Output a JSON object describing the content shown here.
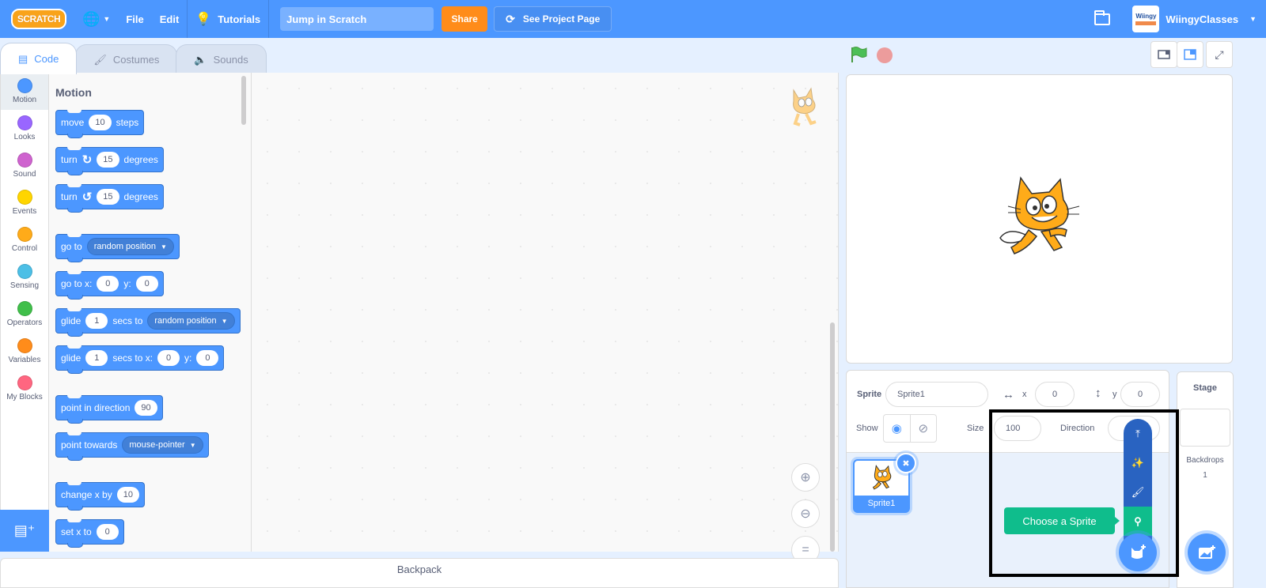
{
  "menubar": {
    "logo": "SCRATCH",
    "language_icon": "globe-icon",
    "file": "File",
    "edit": "Edit",
    "tutorials": "Tutorials",
    "project_title": "Jump in Scratch",
    "share": "Share",
    "see_project_page": "See Project Page",
    "avatar_text": "Wiingy",
    "username": "WiingyClasses"
  },
  "tabs": [
    {
      "label": "Code",
      "icon": "code-icon",
      "active": true
    },
    {
      "label": "Costumes",
      "icon": "brush-icon",
      "active": false
    },
    {
      "label": "Sounds",
      "icon": "speaker-icon",
      "active": false
    }
  ],
  "categories": [
    {
      "label": "Motion",
      "color": "#4c97ff"
    },
    {
      "label": "Looks",
      "color": "#9966ff"
    },
    {
      "label": "Sound",
      "color": "#cf63cf"
    },
    {
      "label": "Events",
      "color": "#ffd500"
    },
    {
      "label": "Control",
      "color": "#ffab19"
    },
    {
      "label": "Sensing",
      "color": "#4cbfe6"
    },
    {
      "label": "Operators",
      "color": "#40bf4a"
    },
    {
      "label": "Variables",
      "color": "#ff8c1a"
    },
    {
      "label": "My Blocks",
      "color": "#ff6680"
    }
  ],
  "flyout": {
    "title": "Motion",
    "blocks": {
      "move": {
        "a": "move",
        "v": "10",
        "b": "steps"
      },
      "turn_right": {
        "a": "turn",
        "v": "15",
        "b": "degrees"
      },
      "turn_left": {
        "a": "turn",
        "v": "15",
        "b": "degrees"
      },
      "goto": {
        "a": "go to",
        "d": "random position"
      },
      "goto_xy": {
        "a": "go to x:",
        "x": "0",
        "b": "y:",
        "y": "0"
      },
      "glide": {
        "a": "glide",
        "v": "1",
        "b": "secs to",
        "d": "random position"
      },
      "glide_xy": {
        "a": "glide",
        "v": "1",
        "b": "secs to x:",
        "x": "0",
        "c": "y:",
        "y": "0"
      },
      "point_dir": {
        "a": "point in direction",
        "v": "90"
      },
      "point_towards": {
        "a": "point towards",
        "d": "mouse-pointer"
      },
      "change_x": {
        "a": "change x by",
        "v": "10"
      },
      "set_x": {
        "a": "set x to",
        "v": "0"
      }
    }
  },
  "backpack": "Backpack",
  "sprite_info": {
    "sprite_label": "Sprite",
    "sprite_name": "Sprite1",
    "x_label": "x",
    "x_value": "0",
    "y_label": "y",
    "y_value": "0",
    "show_label": "Show",
    "size_label": "Size",
    "size_value": "100",
    "direction_label": "Direction"
  },
  "sprites": [
    {
      "name": "Sprite1",
      "selected": true
    }
  ],
  "add_sprite_menu": {
    "items": [
      "upload-icon",
      "surprise-icon",
      "paint-icon",
      "search-icon"
    ],
    "tooltip": "Choose a Sprite"
  },
  "stage_pane": {
    "title": "Stage",
    "backdrops_label": "Backdrops",
    "backdrops_count": "1"
  }
}
